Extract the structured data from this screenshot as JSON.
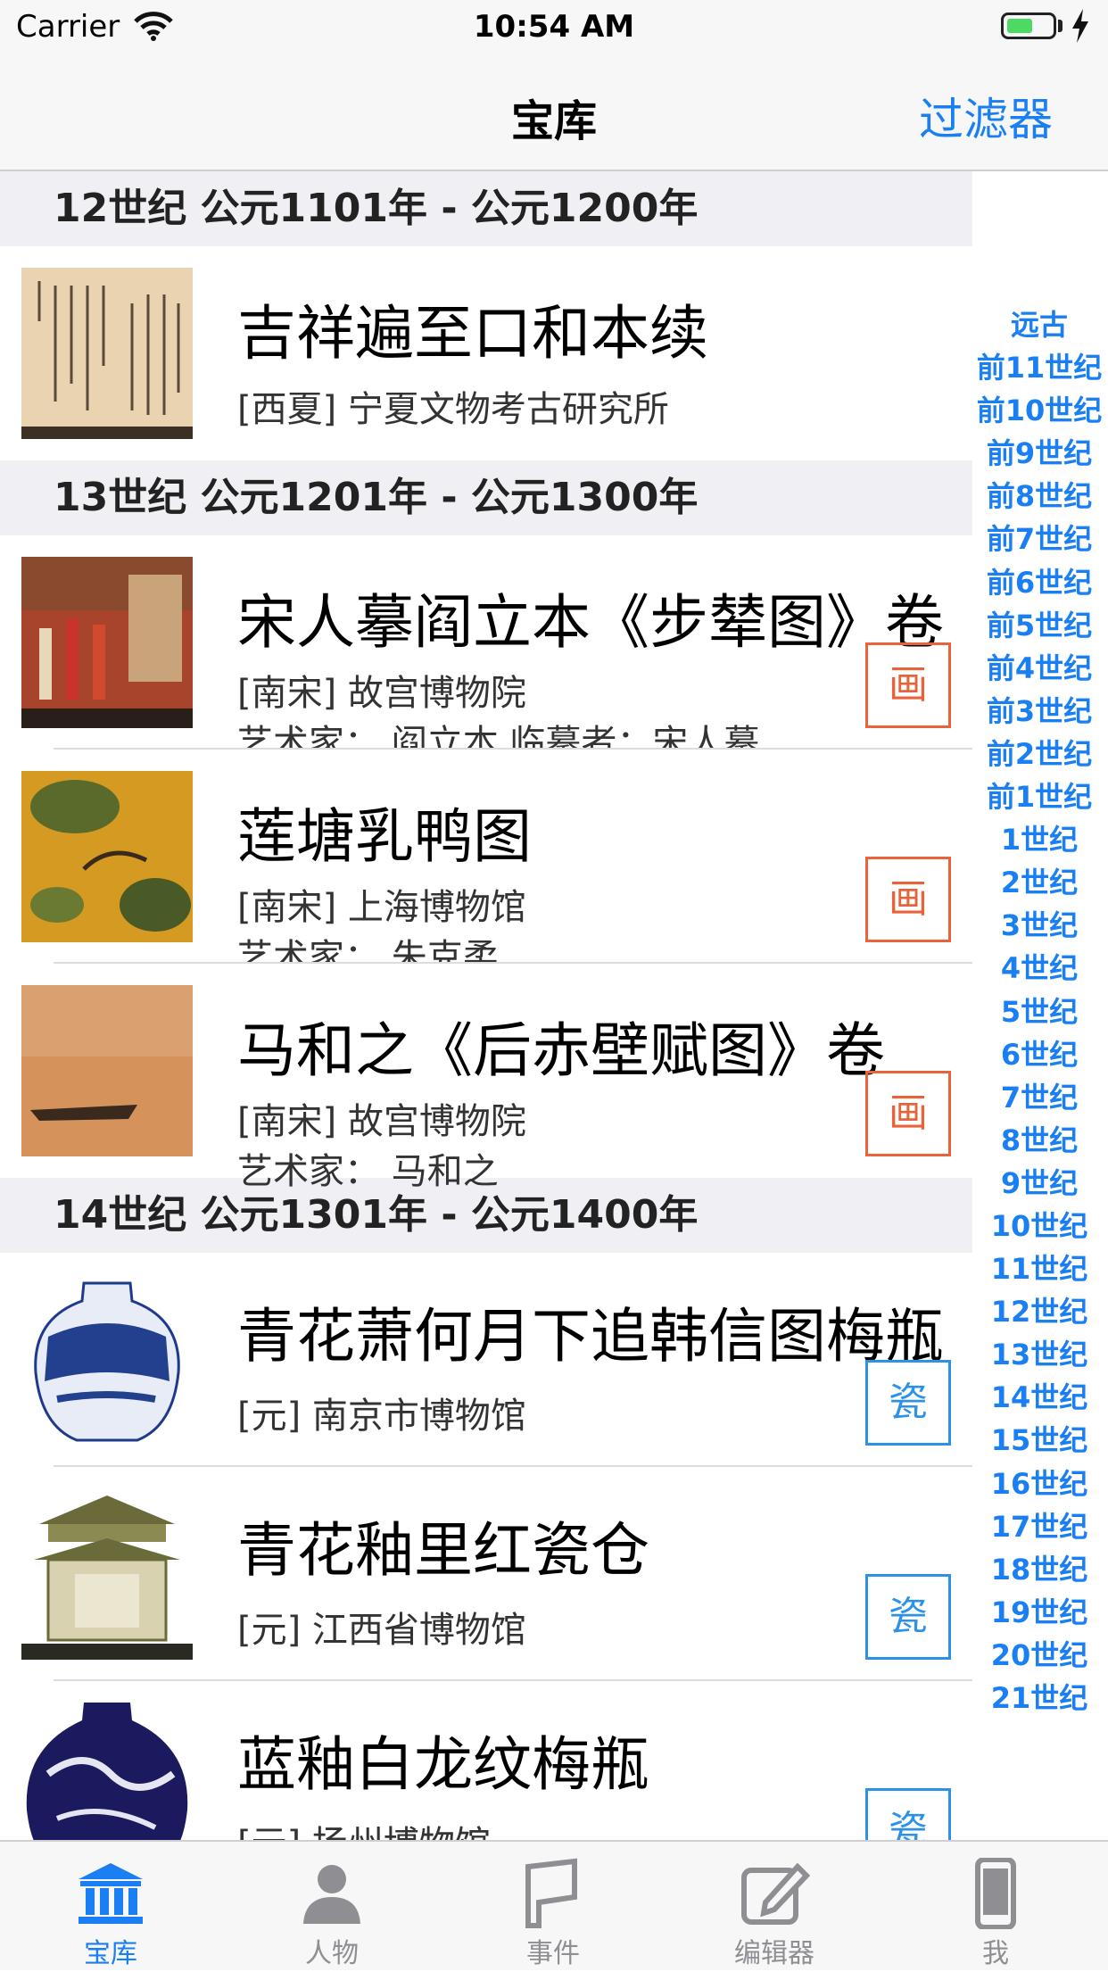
{
  "status_bar": {
    "carrier": "Carrier",
    "time": "10:54 AM"
  },
  "nav": {
    "title": "宝库",
    "filter": "过滤器"
  },
  "sections": [
    {
      "header": "12世纪 公元1101年 - 公元1200年",
      "rows": [
        {
          "title": "吉祥遍至口和本续",
          "line1": "[西夏] 宁夏文物考古研究所",
          "line2": "",
          "badge": "",
          "badge_color": "",
          "thumb": "manuscript"
        }
      ]
    },
    {
      "header": "13世纪 公元1201年 - 公元1300年",
      "rows": [
        {
          "title": "宋人摹阎立本《步辇图》卷",
          "line1": "[南宋] 故宫博物院",
          "line2": "艺术家： 阎立本 临摹者：宋人摹",
          "badge": "画",
          "badge_color": "#e8633a",
          "thumb": "painting-red"
        },
        {
          "title": "莲塘乳鸭图",
          "line1": "[南宋] 上海博物馆",
          "line2": "艺术家： 朱克柔",
          "badge": "画",
          "badge_color": "#e8633a",
          "thumb": "painting-yellow"
        },
        {
          "title": "马和之《后赤壁赋图》卷",
          "line1": "[南宋] 故宫博物院",
          "line2": "艺术家： 马和之",
          "badge": "画",
          "badge_color": "#e8633a",
          "thumb": "painting-tan"
        }
      ]
    },
    {
      "header": "14世纪 公元1301年 - 公元1400年",
      "rows": [
        {
          "title": "青花萧何月下追韩信图梅瓶",
          "line1": "[元] 南京市博物馆",
          "line2": "",
          "badge": "瓷",
          "badge_color": "#2c92e8",
          "thumb": "vase-blue"
        },
        {
          "title": "青花釉里红瓷仓",
          "line1": "[元] 江西省博物馆",
          "line2": "",
          "badge": "瓷",
          "badge_color": "#2c92e8",
          "thumb": "granary"
        },
        {
          "title": "蓝釉白龙纹梅瓶",
          "line1": "[元] 扬州博物馆",
          "line2": "",
          "badge": "瓷",
          "badge_color": "#2c92e8",
          "thumb": "vase-dark"
        }
      ]
    }
  ],
  "section_index": [
    "远古",
    "前11世纪",
    "前10世纪",
    "前9世纪",
    "前8世纪",
    "前7世纪",
    "前6世纪",
    "前5世纪",
    "前4世纪",
    "前3世纪",
    "前2世纪",
    "前1世纪",
    "1世纪",
    "2世纪",
    "3世纪",
    "4世纪",
    "5世纪",
    "6世纪",
    "7世纪",
    "8世纪",
    "9世纪",
    "10世纪",
    "11世纪",
    "12世纪",
    "13世纪",
    "14世纪",
    "15世纪",
    "16世纪",
    "17世纪",
    "18世纪",
    "19世纪",
    "20世纪",
    "21世纪"
  ],
  "tabs": [
    {
      "label": "宝库",
      "icon": "museum-icon",
      "active": true
    },
    {
      "label": "人物",
      "icon": "person-icon",
      "active": false
    },
    {
      "label": "事件",
      "icon": "flag-icon",
      "active": false
    },
    {
      "label": "编辑器",
      "icon": "edit-icon",
      "active": false
    },
    {
      "label": "我",
      "icon": "phone-icon",
      "active": false
    }
  ],
  "colors": {
    "accent": "#1a7ff2",
    "painting_badge": "#e8633a",
    "porcelain_badge": "#2c92e8",
    "section_bg": "#efeff4"
  }
}
